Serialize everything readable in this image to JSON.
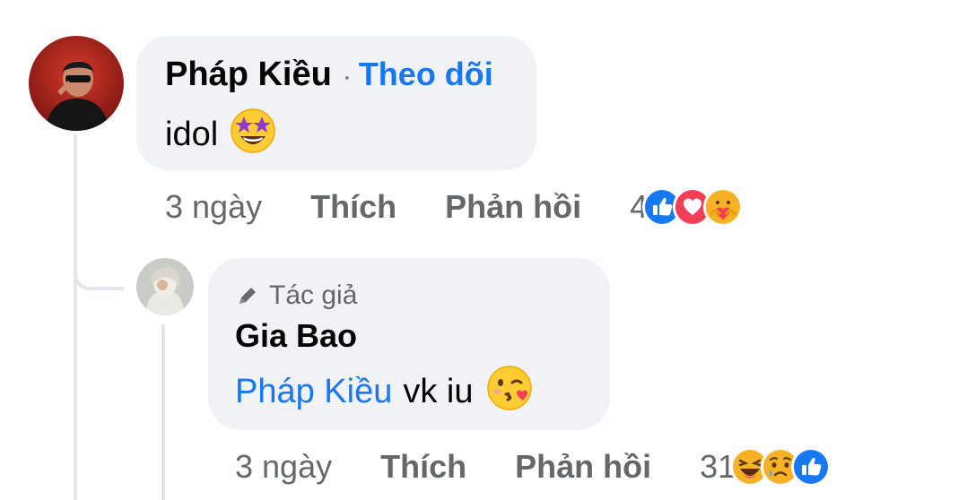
{
  "comment": {
    "author": "Pháp Kiều",
    "separator": "·",
    "follow_label": "Theo dõi",
    "text": "idol",
    "emoji": "star-struck",
    "time": "3 ngày",
    "like_label": "Thích",
    "reply_label": "Phản hồi",
    "reaction_count": "4",
    "reactions": [
      "like-icon",
      "love-icon",
      "care-icon"
    ]
  },
  "reply": {
    "badge_label": "Tác giả",
    "author": "Gia Bao",
    "mention": "Pháp Kiều",
    "text": "vk iu",
    "emoji": "kissing-heart",
    "time": "3 ngày",
    "like_label": "Thích",
    "reply_label": "Phản hồi",
    "reaction_count": "31",
    "reactions": [
      "haha-icon",
      "sad-icon",
      "like-icon"
    ]
  },
  "colors": {
    "bubble": "#f0f2f5",
    "link": "#1877f2",
    "muted": "#65676b",
    "thread_line": "#e4e6eb"
  }
}
